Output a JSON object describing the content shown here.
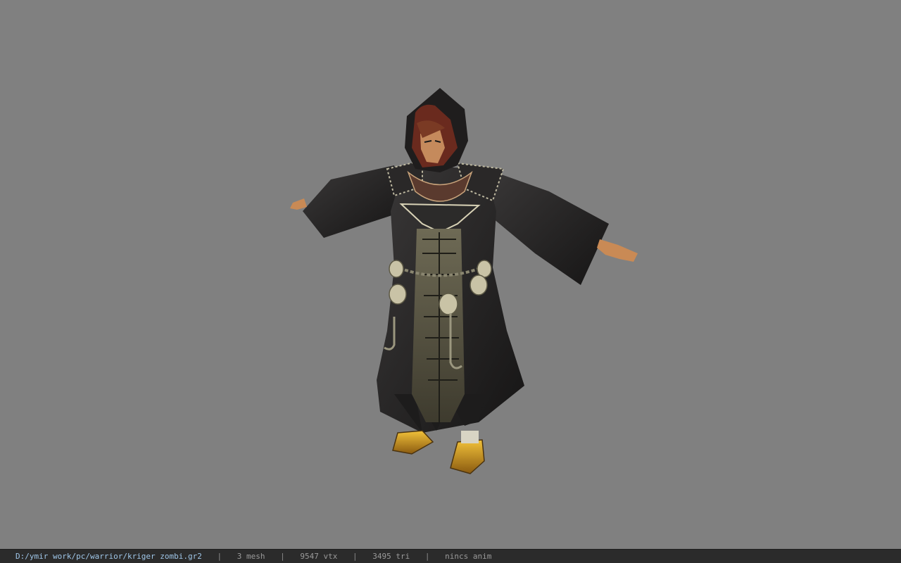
{
  "viewport": {
    "background": "#808080",
    "model_description_icon": "hooded-robed-character-model"
  },
  "status": {
    "path": "D:/ymir work/pc/warrior/kriger zombi.gr2",
    "separator": "|",
    "mesh": "3 mesh",
    "vtx": "9547 vtx",
    "tri": "3495 tri",
    "anim": "nincs anim"
  }
}
